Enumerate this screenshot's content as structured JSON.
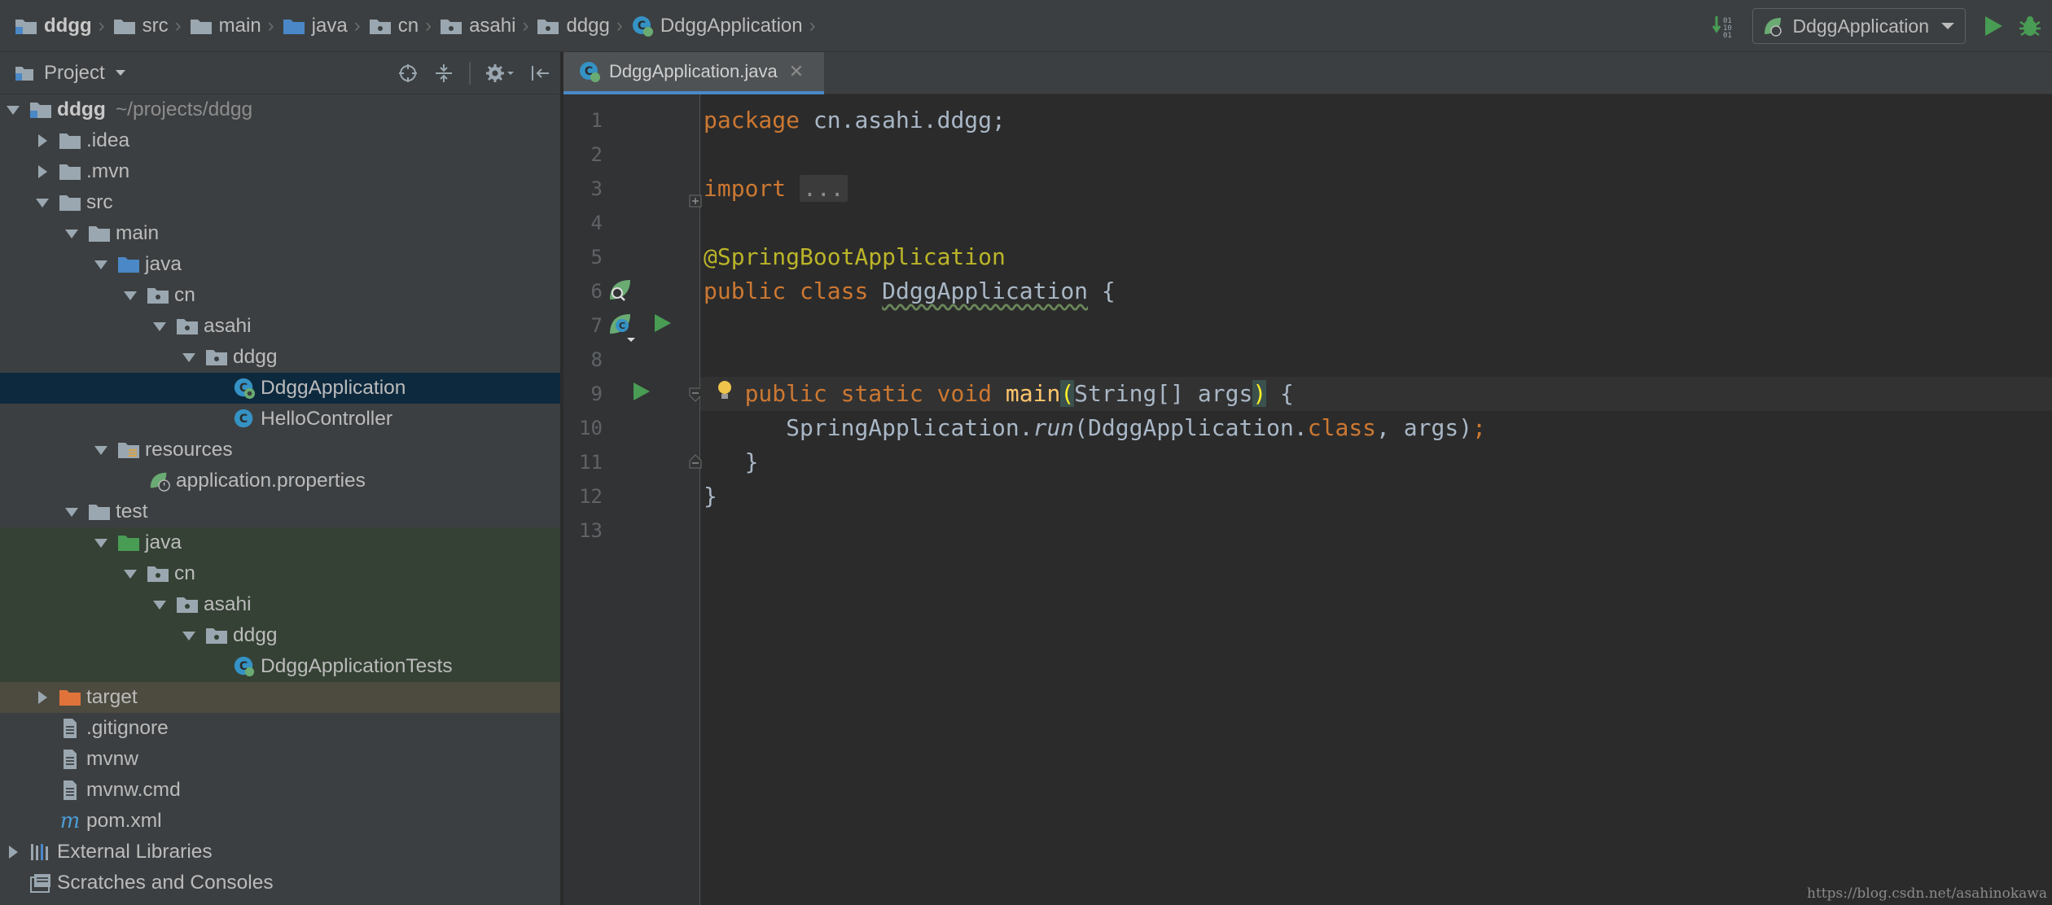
{
  "breadcrumbs": [
    {
      "label": "ddgg",
      "icon": "module-folder-icon"
    },
    {
      "label": "src",
      "icon": "folder-icon"
    },
    {
      "label": "main",
      "icon": "folder-icon"
    },
    {
      "label": "java",
      "icon": "source-folder-icon"
    },
    {
      "label": "cn",
      "icon": "package-icon"
    },
    {
      "label": "asahi",
      "icon": "package-icon"
    },
    {
      "label": "ddgg",
      "icon": "package-icon"
    },
    {
      "label": "DdggApplication",
      "icon": "spring-boot-class-icon"
    }
  ],
  "toolbar": {
    "run_config": "DdggApplication",
    "run_icon": "play-icon",
    "debug_icon": "debug-bug-icon",
    "build_icon": "build-icon"
  },
  "project_panel": {
    "title": "Project",
    "tree": [
      {
        "label": "ddgg",
        "sub": "~/projects/ddgg",
        "arrow": "down"
      },
      {
        "label": ".idea",
        "arrow": "right"
      },
      {
        "label": ".mvn",
        "arrow": "right"
      },
      {
        "label": "src",
        "arrow": "down"
      },
      {
        "label": "main",
        "arrow": "down"
      },
      {
        "label": "java",
        "arrow": "down"
      },
      {
        "label": "cn",
        "arrow": "down"
      },
      {
        "label": "asahi",
        "arrow": "down"
      },
      {
        "label": "ddgg",
        "arrow": "down"
      },
      {
        "label": "DdggApplication",
        "state": "selected"
      },
      {
        "label": "HelloController"
      },
      {
        "label": "resources",
        "arrow": "down"
      },
      {
        "label": "application.properties"
      },
      {
        "label": "test",
        "arrow": "down"
      },
      {
        "label": "java",
        "arrow": "down",
        "state": "test"
      },
      {
        "label": "cn",
        "arrow": "down",
        "state": "test"
      },
      {
        "label": "asahi",
        "arrow": "down",
        "state": "test"
      },
      {
        "label": "ddgg",
        "arrow": "down",
        "state": "test"
      },
      {
        "label": "DdggApplicationTests",
        "state": "test"
      },
      {
        "label": "target",
        "arrow": "right",
        "state": "excluded"
      },
      {
        "label": ".gitignore"
      },
      {
        "label": "mvnw"
      },
      {
        "label": "mvnw.cmd"
      },
      {
        "label": "pom.xml"
      },
      {
        "label": "External Libraries",
        "arrow": "right"
      },
      {
        "label": "Scratches and Consoles"
      }
    ]
  },
  "editor": {
    "tab_label": "DdggApplication.java",
    "line_numbers": [
      "1",
      "2",
      "3",
      "4",
      "5",
      "6",
      "7",
      "8",
      "9",
      "10",
      "11",
      "12",
      "13"
    ],
    "code": {
      "l1_kw": "package",
      "l1_rest": " cn.asahi.ddgg;",
      "l3_kw": "import",
      "l3_fold": "...",
      "l6_ann": "@SpringBootApplication",
      "l7_public": "public",
      "l7_class": " class ",
      "l7_name": "DdggApplication",
      "l7_rest": " {",
      "l9_mods": "public static void",
      "l9_fn": "main",
      "l9_paren_open": "(",
      "l9_params": "String[] args",
      "l9_paren_close": ")",
      "l9_rest": " {",
      "l10_a": "SpringApplication.",
      "l10_run": "run",
      "l10_b": "(DdggApplication.",
      "l10_class": "class",
      "l10_c": ", args)",
      "l10_semi": ";",
      "l11": "}",
      "l12": "}"
    }
  },
  "watermark": "https://blog.csdn.net/asahinokawa",
  "colors": {
    "keyword": "#cc7832",
    "annotation": "#bbb529",
    "function": "#ffc66d",
    "selection": "#0d293e",
    "test_bg": "#344134",
    "excluded_bg": "#4d4a3f",
    "tab_underline": "#4a88c7",
    "run_green": "#499c54"
  }
}
